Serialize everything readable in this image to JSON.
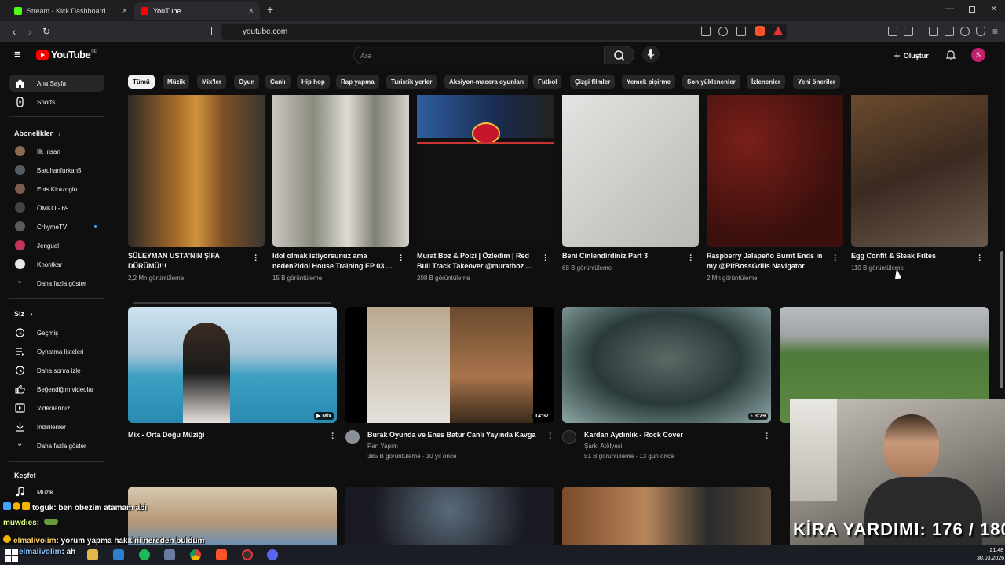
{
  "browser": {
    "tabs": [
      {
        "label": "Stream - Kick Dashboard",
        "active": false
      },
      {
        "label": "YouTube",
        "active": true
      }
    ],
    "new_tab": "+",
    "url": "youtube.com"
  },
  "header": {
    "logo_text": "YouTube",
    "logo_region": "DE",
    "search_placeholder": "Ara",
    "create_label": "Oluştur",
    "avatar_letter": "S"
  },
  "chips": [
    "Tümü",
    "Müzik",
    "Mix'ler",
    "Oyun",
    "Canlı",
    "Hip hop",
    "Rap yapma",
    "Turistik yerler",
    "Aksiyon-macera oyunları",
    "Futbol",
    "Çizgi filmler",
    "Yemek pişirme",
    "Son yüklenenler",
    "İzlenenler",
    "Yeni öneriler"
  ],
  "sidebar": {
    "main": [
      {
        "label": "Ana Sayfa",
        "icon": "home-icon"
      },
      {
        "label": "Shorts",
        "icon": "shorts-icon"
      }
    ],
    "subs_title": "Abonelikler",
    "subs": [
      "İlk İnsan",
      "Batuhanfurkan5",
      "Enis Kirazoglu",
      "ÖMKO - 69",
      "CrhymeTV",
      "Jenguel",
      "Khontkar"
    ],
    "subs_more": "Daha fazla göster",
    "you_title": "Siz",
    "you": [
      {
        "label": "Geçmiş",
        "icon": "history-icon"
      },
      {
        "label": "Oynatma listeleri",
        "icon": "playlist-icon"
      },
      {
        "label": "Daha sonra izle",
        "icon": "clock-icon"
      },
      {
        "label": "Beğendiğim videolar",
        "icon": "thumbs-up-icon"
      },
      {
        "label": "Videolarınız",
        "icon": "video-icon"
      },
      {
        "label": "İndirilenler",
        "icon": "download-icon"
      }
    ],
    "you_more": "Daha fazla göster",
    "explore_title": "Keşfet",
    "explore": [
      {
        "label": "Müzik",
        "icon": "music-icon"
      }
    ]
  },
  "shorts_row": [
    {
      "title": "SÜLEYMAN USTA'NIN ŞİFA DÜRÜMÜ!!!",
      "views": "2,2 Mn görüntüleme"
    },
    {
      "title": "Idol olmak istiyorsunuz ama neden?Idol House Training EP 03 ...",
      "views": "15 B görüntüleme"
    },
    {
      "title": "Murat Boz & Poizi | Özledim | Red Bull Track Takeover @muratboz ...",
      "views": "208 B görüntüleme"
    },
    {
      "title": "Beni Cinlendirdiniz Part 3",
      "views": "68 B görüntüleme"
    },
    {
      "title": "Raspberry Jalapeño Burnt Ends in my @PitBossGrills Navigator",
      "views": "2 Mn görüntüleme"
    },
    {
      "title": "Egg Confit & Steak Frites",
      "views": "110 B görüntüleme"
    }
  ],
  "videos": [
    {
      "title": "Mix - Orta Doğu Müziği",
      "badge": "Mix",
      "channel": "",
      "meta": ""
    },
    {
      "title": "Burak Oyunda ve Enes Batur Canlı Yayında Kavga",
      "duration": "14:37",
      "channel": "Pan Yapım",
      "meta": "385 B görüntüleme · 10 yıl önce"
    },
    {
      "title": "Kardan Aydınlık - Rock Cover",
      "duration": "3:29",
      "channel": "Şarkı Atölyesi",
      "meta": "51 B görüntüleme · 13 gün önce"
    }
  ],
  "overlay": {
    "chat": [
      {
        "user": "toguk",
        "msg": ": ben obezim atamam abi"
      },
      {
        "user": "muwdies",
        "msg": ":"
      },
      {
        "user": "elmalivolim",
        "msg": ": yorum yapma hakkini nereden buldum"
      },
      {
        "user": "elmalivolim",
        "msg": ": ah"
      }
    ],
    "kira_text": "KİRA YARDIMI:  176 / 180"
  },
  "taskbar": {
    "time": "21:48",
    "date": "30.03.2026"
  },
  "colors": {
    "accent": "#ff0000",
    "bg": "#0f0f0f",
    "chip": "#272727",
    "avatar": "#c21f6d"
  }
}
